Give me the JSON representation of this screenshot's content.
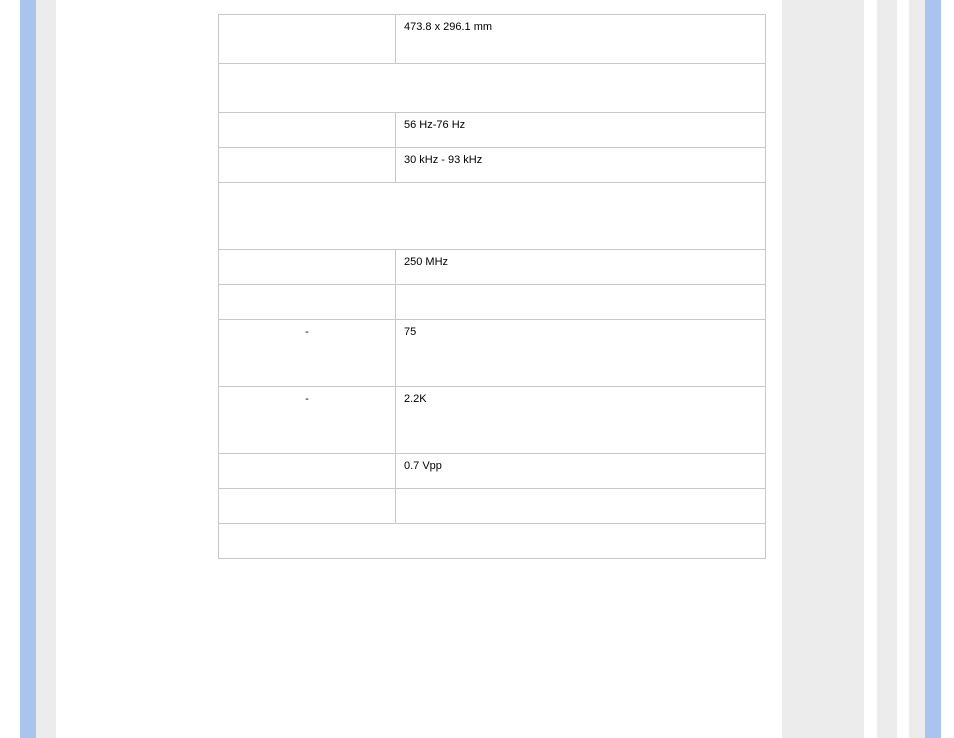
{
  "spec_rows": [
    {
      "kind": "pair",
      "label": "",
      "value": "473.8 x 296.1 mm",
      "row_class": "med"
    },
    {
      "kind": "section",
      "value": "",
      "row_class": "med"
    },
    {
      "kind": "pair",
      "label": "",
      "value": "56 Hz-76 Hz",
      "row_class": "short"
    },
    {
      "kind": "pair",
      "label": "",
      "value": "30 kHz - 93 kHz",
      "row_class": "short"
    },
    {
      "kind": "section",
      "value": "",
      "row_class": "tall"
    },
    {
      "kind": "pair",
      "label": "",
      "value": "250 MHz",
      "row_class": "short"
    },
    {
      "kind": "pair",
      "label": "",
      "value": "",
      "row_class": "short"
    },
    {
      "kind": "pair",
      "label": "-",
      "value": "75",
      "row_class": "tall"
    },
    {
      "kind": "pair",
      "label": "-",
      "value": "2.2K",
      "row_class": "tall"
    },
    {
      "kind": "pair",
      "label": "",
      "value": "0.7 Vpp",
      "row_class": "short"
    },
    {
      "kind": "pair",
      "label": "",
      "value": "",
      "row_class": "short"
    },
    {
      "kind": "section",
      "value": "",
      "row_class": "short"
    }
  ]
}
